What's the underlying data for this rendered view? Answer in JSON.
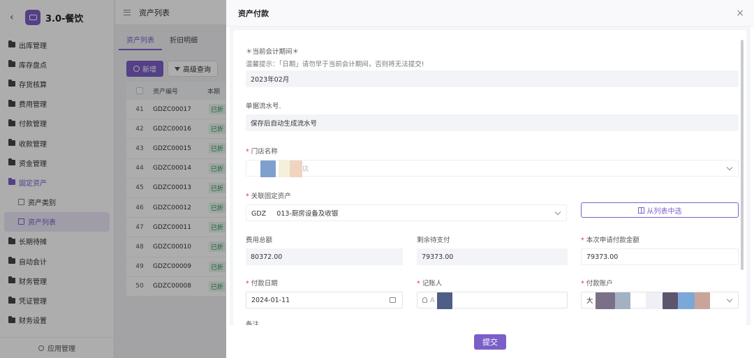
{
  "app": {
    "title": "3.0-餐饮",
    "back": "‹"
  },
  "sidebar": {
    "items": [
      {
        "label": "出库管理"
      },
      {
        "label": "库存盘点"
      },
      {
        "label": "存货核算"
      },
      {
        "label": "费用管理"
      },
      {
        "label": "付款管理"
      },
      {
        "label": "收款管理"
      },
      {
        "label": "资金管理"
      },
      {
        "label": "固定资产"
      },
      {
        "label": "资产类别"
      },
      {
        "label": "资产列表"
      },
      {
        "label": "长期待摊"
      },
      {
        "label": "自动会计"
      },
      {
        "label": "财务管理"
      },
      {
        "label": "凭证管理"
      },
      {
        "label": "财务设置"
      }
    ],
    "footer": "应用管理"
  },
  "topbar": {
    "breadcrumb": "资产列表"
  },
  "tabs": [
    "资产列表",
    "折旧明细"
  ],
  "toolbar": {
    "new": "新增",
    "advanced": "高级查询"
  },
  "table": {
    "headers": [
      "资产编号",
      "本期"
    ],
    "rows": [
      {
        "no": "41",
        "code": "GDZC00017",
        "status": "已折"
      },
      {
        "no": "42",
        "code": "GDZC00016",
        "status": "已折"
      },
      {
        "no": "43",
        "code": "GDZC00015",
        "status": "已折"
      },
      {
        "no": "44",
        "code": "GDZC00014",
        "status": "已折"
      },
      {
        "no": "45",
        "code": "GDZC00013",
        "status": "已折"
      },
      {
        "no": "46",
        "code": "GDZC00012",
        "status": "已折"
      },
      {
        "no": "47",
        "code": "GDZC00011",
        "status": "已折"
      },
      {
        "no": "48",
        "code": "GDZC00010",
        "status": "已折"
      },
      {
        "no": "49",
        "code": "GDZC00009",
        "status": "已折"
      },
      {
        "no": "50",
        "code": "GDZC00008",
        "status": "已折"
      }
    ]
  },
  "drawer": {
    "title": "资产付款",
    "close": "×",
    "period_label": "＊当前会计期间＊",
    "period_hint": "温馨提示：「日期」请勿早于当前会计期间，否则将无法提交!",
    "period_value": "2023年02月",
    "serial_label": "单据流水号.",
    "serial_value": "保存后自动生成流水号",
    "store_label": "门店名称",
    "store_value_tail": "店",
    "asset_label": "关联固定资产",
    "asset_value": "GDZ     013-厨房设备及收银",
    "pick_from_list": "从列表中选",
    "total_label": "费用总额",
    "total_value": "80372.00",
    "remain_label": "剩余待支付",
    "remain_value": "79373.00",
    "apply_label": "本次申请付款金额",
    "apply_value": "79373.00",
    "date_label": "付款日期",
    "date_value": "2024-01-11",
    "recorder_label": "记账人",
    "recorder_prefix": "A",
    "account_label": "付款账户",
    "account_prefix": "大",
    "remark_label": "备注",
    "submit": "提交"
  },
  "colors": {
    "accent": "#7b5fc8"
  }
}
